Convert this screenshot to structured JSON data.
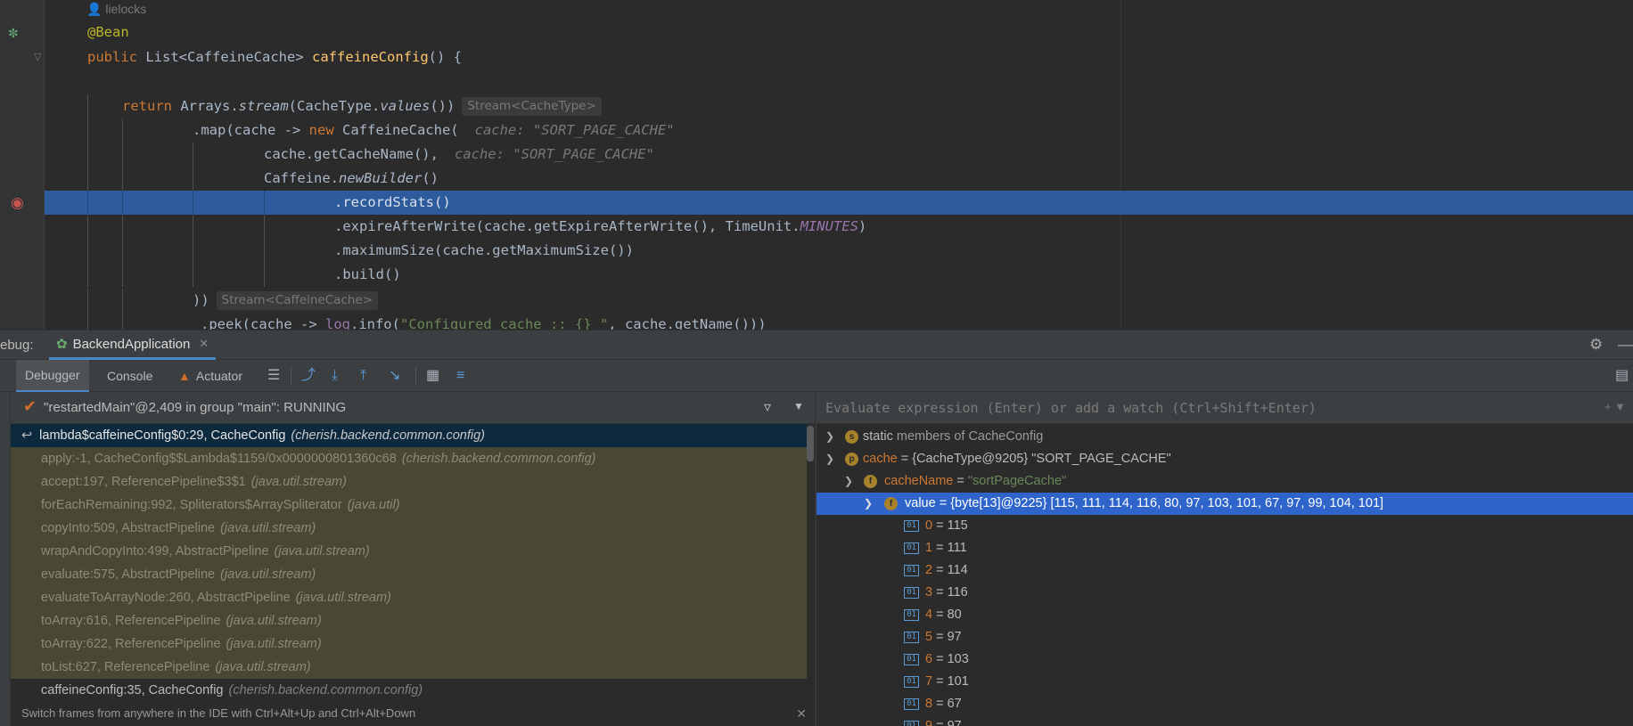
{
  "editor": {
    "author": "lielocks",
    "lines": {
      "annotation": "@Bean",
      "kw_public": "public",
      "return_type": "List<CaffeineCache>",
      "method_name": "caffeineConfig",
      "method_tail": "() {",
      "kw_return": "return",
      "arrays_stream_pre": "Arrays.",
      "arrays_stream_fn": "stream",
      "arrays_stream_mid": "(CacheType.",
      "values_fn": "values",
      "arrays_stream_post": "())",
      "hint_stream_cachetype": "Stream<CacheType>",
      "map_pre": ".map(cache -> ",
      "kw_new": "new",
      "map_post": " CaffeineCache(",
      "inline_cache_1": "cache: \"SORT_PAGE_CACHE\"",
      "get_cache_name": "cache.getCacheName(),",
      "inline_cache_2": "cache: \"SORT_PAGE_CACHE\"",
      "caffeine_pre": "Caffeine.",
      "caffeine_fn": "newBuilder",
      "caffeine_post": "()",
      "record_stats": ".recordStats()",
      "expire_pre": ".expireAfterWrite(cache.getExpireAfterWrite(), TimeUnit.",
      "expire_const": "MINUTES",
      "expire_post": ")",
      "maximum_size": ".maximumSize(cache.getMaximumSize())",
      "build": ".build()",
      "close_parens": "))",
      "hint_stream_caffeinecache": "Stream<CaffeineCache>",
      "peek_pre": ".peek(cache -> ",
      "peek_log": "log",
      "peek_info": ".info(",
      "peek_str": "\"Configured cache :: {} \"",
      "peek_post": ", cache.getName()))"
    }
  },
  "debug": {
    "label": "ebug:",
    "run_config": "BackendApplication",
    "tabs": {
      "debugger": "Debugger",
      "console": "Console",
      "actuator": "Actuator"
    },
    "thread": "\"restartedMain\"@2,409 in group \"main\": RUNNING",
    "frames": [
      {
        "name": "lambda$caffeineConfig$0:29, CacheConfig",
        "pkg": "(cherish.backend.common.config)",
        "kind": "selected"
      },
      {
        "name": "apply:-1, CacheConfig$$Lambda$1159/0x0000000801360c68",
        "pkg": "(cherish.backend.common.config)",
        "kind": "lib"
      },
      {
        "name": "accept:197, ReferencePipeline$3$1",
        "pkg": "(java.util.stream)",
        "kind": "lib"
      },
      {
        "name": "forEachRemaining:992, Spliterators$ArraySpliterator",
        "pkg": "(java.util)",
        "kind": "lib"
      },
      {
        "name": "copyInto:509, AbstractPipeline",
        "pkg": "(java.util.stream)",
        "kind": "lib"
      },
      {
        "name": "wrapAndCopyInto:499, AbstractPipeline",
        "pkg": "(java.util.stream)",
        "kind": "lib"
      },
      {
        "name": "evaluate:575, AbstractPipeline",
        "pkg": "(java.util.stream)",
        "kind": "lib"
      },
      {
        "name": "evaluateToArrayNode:260, AbstractPipeline",
        "pkg": "(java.util.stream)",
        "kind": "lib"
      },
      {
        "name": "toArray:616, ReferencePipeline",
        "pkg": "(java.util.stream)",
        "kind": "lib"
      },
      {
        "name": "toArray:622, ReferencePipeline",
        "pkg": "(java.util.stream)",
        "kind": "lib"
      },
      {
        "name": "toList:627, ReferencePipeline",
        "pkg": "(java.util.stream)",
        "kind": "lib"
      },
      {
        "name": "caffeineConfig:35, CacheConfig",
        "pkg": "(cherish.backend.common.config)",
        "kind": "normal"
      }
    ],
    "frames_hint": "Switch frames from anywhere in the IDE with Ctrl+Alt+Up and Ctrl+Alt+Down",
    "eval_placeholder": "Evaluate expression (Enter) or add a watch (Ctrl+Shift+Enter)",
    "variables": {
      "static_label": "static",
      "static_rest": "members of CacheConfig",
      "cache_name": "cache",
      "cache_eq": " = ",
      "cache_type": "{CacheType@9205}",
      "cache_str": "\"SORT_PAGE_CACHE\"",
      "cachename_name": "cacheName",
      "cachename_eq": " = ",
      "cachename_str": "\"sortPageCache\"",
      "value_name": "value",
      "value_eq": " = ",
      "value_type": "{byte[13]@9225} [115, 111, 114, 116, 80, 97, 103, 101, 67, 97, 99, 104, 101]",
      "array_items": [
        {
          "idx": "0",
          "val": " = 115"
        },
        {
          "idx": "1",
          "val": " = 111"
        },
        {
          "idx": "2",
          "val": " = 114"
        },
        {
          "idx": "3",
          "val": " = 116"
        },
        {
          "idx": "4",
          "val": " = 80"
        },
        {
          "idx": "5",
          "val": " = 97"
        },
        {
          "idx": "6",
          "val": " = 103"
        },
        {
          "idx": "7",
          "val": " = 101"
        },
        {
          "idx": "8",
          "val": " = 67"
        },
        {
          "idx": "9",
          "val": " = 97"
        }
      ]
    }
  },
  "colors": {
    "current_line": "#2d5b9c",
    "selected_var": "#2f65ca",
    "library_frame": "#4b4735",
    "accent": "#4a88c7"
  },
  "icons": [
    "spring-bean-icon",
    "fold-icon",
    "breakpoint-icon",
    "settings-icon",
    "minimize-icon",
    "filter-icon",
    "chevron-down-icon"
  ]
}
